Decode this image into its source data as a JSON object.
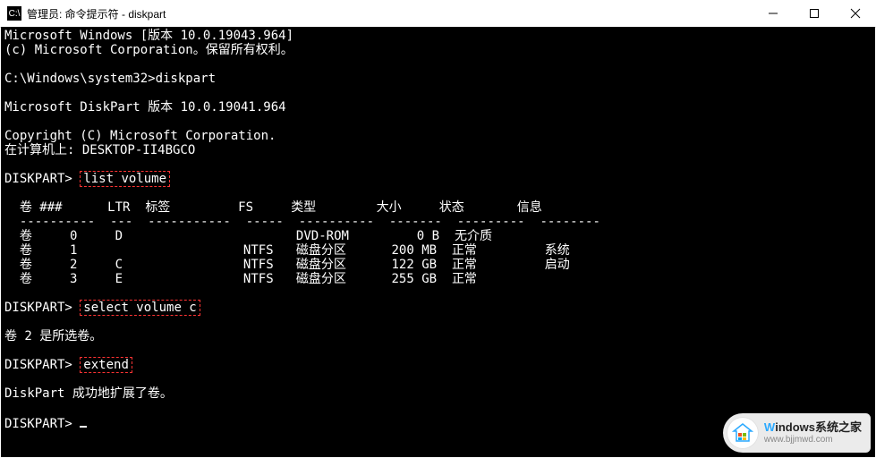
{
  "window": {
    "title": "管理员: 命令提示符 - diskpart"
  },
  "terminal": {
    "line1": "Microsoft Windows [版本 10.0.19043.964]",
    "line2": "(c) Microsoft Corporation。保留所有权利。",
    "path_prompt": "C:\\Windows\\system32>",
    "cmd_diskpart": "diskpart",
    "dp_version": "Microsoft DiskPart 版本 10.0.19041.964",
    "copyright": "Copyright (C) Microsoft Corporation.",
    "on_computer": "在计算机上: DESKTOP-II4BGCO",
    "diskpart_prompt": "DISKPART>",
    "cmd_list_volume": "list volume",
    "header": {
      "volnum": "卷 ###",
      "ltr": "LTR",
      "label": "标签",
      "fs": "FS",
      "type": "类型",
      "size": "大小",
      "status": "状态",
      "info": "信息"
    },
    "rows": [
      {
        "idx": "0",
        "ltr": "D",
        "label": "",
        "fs": "",
        "type": "DVD-ROM",
        "size": "0 B",
        "status": "无介质",
        "info": ""
      },
      {
        "idx": "1",
        "ltr": "",
        "label": "",
        "fs": "NTFS",
        "type": "磁盘分区",
        "size": "200 MB",
        "status": "正常",
        "info": "系统"
      },
      {
        "idx": "2",
        "ltr": "C",
        "label": "",
        "fs": "NTFS",
        "type": "磁盘分区",
        "size": "122 GB",
        "status": "正常",
        "info": "启动"
      },
      {
        "idx": "3",
        "ltr": "E",
        "label": "",
        "fs": "NTFS",
        "type": "磁盘分区",
        "size": "255 GB",
        "status": "正常",
        "info": ""
      }
    ],
    "cmd_select": "select volume c",
    "selected_msg": "卷 2 是所选卷。",
    "cmd_extend": "extend",
    "extend_msg": "DiskPart 成功地扩展了卷。"
  },
  "watermark": {
    "brand_prefix": "W",
    "brand_rest": "indows",
    "brand_suffix": "系统之家",
    "url": "www.bjjmwd.com"
  }
}
